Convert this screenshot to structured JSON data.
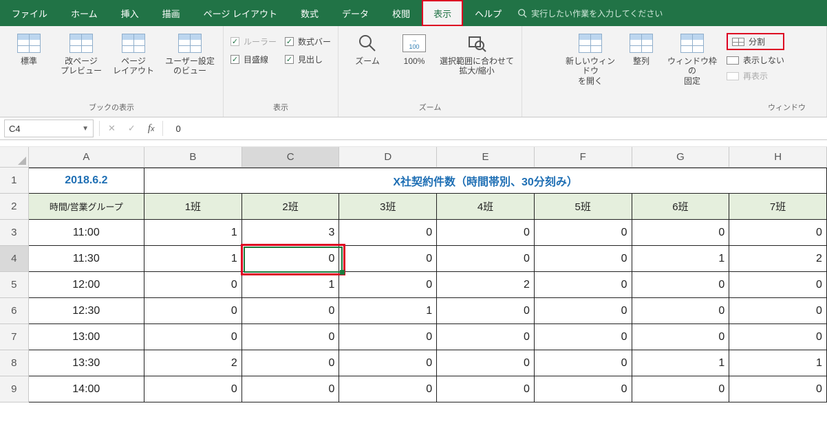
{
  "menu": {
    "items": [
      "ファイル",
      "ホーム",
      "挿入",
      "描画",
      "ページ レイアウト",
      "数式",
      "データ",
      "校閲",
      "表示",
      "ヘルプ"
    ],
    "active_index": 8,
    "search_placeholder": "実行したい作業を入力してください"
  },
  "ribbon": {
    "views": {
      "items": [
        "標準",
        "改ページ\nプレビュー",
        "ページ\nレイアウト",
        "ユーザー設定\nのビュー"
      ],
      "label": "ブックの表示"
    },
    "show": {
      "ruler": "ルーラー",
      "formula": "数式バー",
      "grid": "目盛線",
      "head": "見出し",
      "label": "表示"
    },
    "zoom": {
      "zoom": "ズーム",
      "p100": "100%",
      "fit": "選択範囲に合わせて\n拡大/縮小",
      "label": "ズーム"
    },
    "window": {
      "neww": "新しいウィンドウ\nを開く",
      "arrange": "整列",
      "freeze": "ウィンドウ枠の\n固定",
      "split": "分割",
      "hide": "表示しない",
      "unhide": "再表示",
      "label": "ウィンドウ"
    }
  },
  "formula": {
    "name": "C4",
    "value": "0"
  },
  "sheet": {
    "cols": [
      "A",
      "B",
      "C",
      "D",
      "E",
      "F",
      "G",
      "H"
    ],
    "selected_col_index": 2,
    "selected_row_index": 3,
    "date": "2018.6.2",
    "title": "X社契約件数（時間帯別、30分刻み）",
    "groups_header": "時間/営業グループ",
    "groups": [
      "1班",
      "2班",
      "3班",
      "4班",
      "5班",
      "6班",
      "7班"
    ],
    "rows": [
      {
        "t": "11:00",
        "v": [
          1,
          3,
          0,
          0,
          0,
          0,
          0
        ]
      },
      {
        "t": "11:30",
        "v": [
          1,
          0,
          0,
          0,
          0,
          1,
          2
        ]
      },
      {
        "t": "12:00",
        "v": [
          0,
          1,
          0,
          2,
          0,
          0,
          0
        ]
      },
      {
        "t": "12:30",
        "v": [
          0,
          0,
          1,
          0,
          0,
          0,
          0
        ]
      },
      {
        "t": "13:00",
        "v": [
          0,
          0,
          0,
          0,
          0,
          0,
          0
        ]
      },
      {
        "t": "13:30",
        "v": [
          2,
          0,
          0,
          0,
          0,
          1,
          1
        ]
      },
      {
        "t": "14:00",
        "v": [
          0,
          0,
          0,
          0,
          0,
          0,
          0
        ]
      }
    ]
  }
}
